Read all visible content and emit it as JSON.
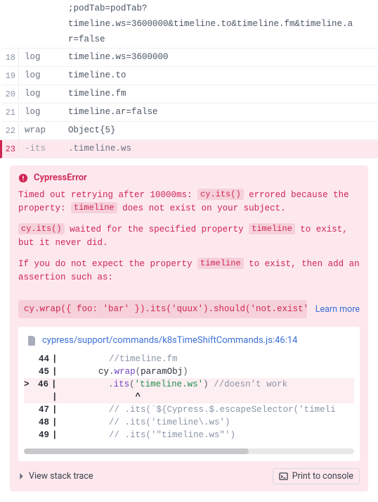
{
  "pre_row": ";podTab=podTab?\ntimeline.ws=3600000&timeline.to&timeline.fm&timeline.a\nr=false",
  "log_rows": [
    {
      "n": "18",
      "cmd": "log",
      "msg": "timeline.ws=3600000",
      "fail": false
    },
    {
      "n": "19",
      "cmd": "log",
      "msg": "timeline.to",
      "fail": false
    },
    {
      "n": "20",
      "cmd": "log",
      "msg": "timeline.fm",
      "fail": false
    },
    {
      "n": "21",
      "cmd": "log",
      "msg": "timeline.ar=false",
      "fail": false
    },
    {
      "n": "22",
      "cmd": "wrap",
      "msg": "Object{5}",
      "fail": false
    },
    {
      "n": "23",
      "cmd": "-its",
      "msg": ".timeline.ws",
      "fail": true
    }
  ],
  "error": {
    "title": "CypressError",
    "p1_a": "Timed out retrying after 10000ms: ",
    "p1_code1": "cy.its()",
    "p1_b": " errored because the property: ",
    "p1_code2": "timeline",
    "p1_c": " does not exist on your subject.",
    "p2_code1": "cy.its()",
    "p2_a": " waited for the specified property ",
    "p2_code2": "timeline",
    "p2_b": " to exist, but it never did.",
    "p3_a": "If you do not expect the property ",
    "p3_code1": "timeline",
    "p3_b": " to exist, then add an assertion such as:",
    "example": "cy.wrap({ foo: 'bar' }).its('quux').should('not.exist')",
    "learn_more": "Learn more",
    "file": "cypress/support/commands/k8sTimeShiftCommands.js:46:14",
    "stack_toggle": "View stack trace",
    "print": "Print to console"
  },
  "code": {
    "caret_prefix": "> ",
    "caret_marker": "^",
    "lines": [
      {
        "n": "44"
      },
      {
        "n": "45"
      },
      {
        "n": "46"
      },
      {
        "n": ""
      },
      {
        "n": "47"
      },
      {
        "n": "48"
      },
      {
        "n": "49"
      }
    ],
    "l44_cmt": "//timeline.fm",
    "l45_ident": "cy",
    "l45_key": "wrap",
    "l45_arg": "paramObj",
    "l46_key": "its",
    "l46_str": "'timeline.ws'",
    "l46_cmt": "//doesn't work",
    "l47_cmt": "// .its(`${Cypress.$.escapeSelector('timeli",
    "l48_cmt": "// .its('timeline\\.ws')",
    "l49_cmt": "// .its('\"timeline.ws\"')"
  }
}
